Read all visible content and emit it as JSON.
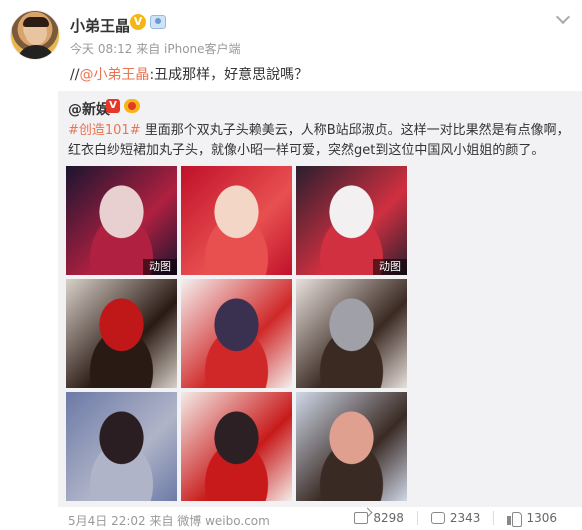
{
  "user": {
    "name": "小弟王晶",
    "badge": "V",
    "meta": "今天 08:12 来自 iPhone客户端"
  },
  "post": {
    "prefix": "//",
    "mention": "@小弟王晶",
    "text": ":丑成那样，好意思說嗎？"
  },
  "repost": {
    "author": "@新娱",
    "badge": "V",
    "tag": "#创造101#",
    "text": " 里面那个双丸子头赖美云，人称B站邱淑贞。这样一对比果然是有点像啊，红衣白纱短裙加丸子头，就像小昭一样可爱，突然get到这位中国风小姐姐的颜了。",
    "images": [
      {
        "label": "动图",
        "colors": [
          "#1a1530",
          "#b02040",
          "#e8d0d0"
        ]
      },
      {
        "label": "",
        "colors": [
          "#c0102a",
          "#e85050",
          "#f3d6c6"
        ]
      },
      {
        "label": "动图",
        "colors": [
          "#2a1e2e",
          "#d03040",
          "#f2f0f0"
        ]
      },
      {
        "label": "",
        "colors": [
          "#d8d0c8",
          "#2a1a14",
          "#c01818"
        ]
      },
      {
        "label": "",
        "colors": [
          "#f4f0ee",
          "#d02828",
          "#3a3050"
        ]
      },
      {
        "label": "",
        "colors": [
          "#e8e0dc",
          "#3a2a22",
          "#a0a0a8"
        ]
      },
      {
        "label": "",
        "colors": [
          "#6c7aa6",
          "#b0b4c8",
          "#2a1e22"
        ]
      },
      {
        "label": "",
        "colors": [
          "#f4ece8",
          "#c81a1a",
          "#2c2024"
        ]
      },
      {
        "label": "",
        "colors": [
          "#cfd8e8",
          "#3a2a24",
          "#e0a090"
        ]
      }
    ]
  },
  "footer": {
    "time": "5月4日 22:02 来自 微博 weibo.com",
    "repost_count": "8298",
    "comment_count": "2343",
    "like_count": "1306"
  }
}
